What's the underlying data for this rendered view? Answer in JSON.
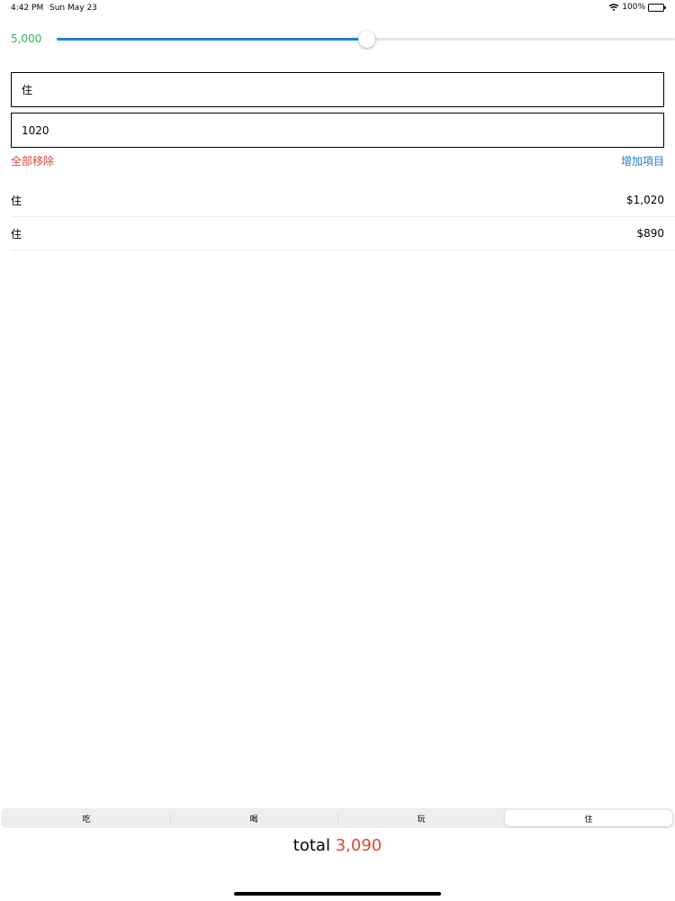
{
  "status_bar": {
    "time": "4:42 PM",
    "date": "Sun May 23",
    "battery": "100%"
  },
  "slider": {
    "value_label": "5,000",
    "fraction": 0.5,
    "label_color": "#2fb55a",
    "fill_color": "#1e7fd8"
  },
  "form": {
    "name_value": "住",
    "amount_value": "1020"
  },
  "actions": {
    "remove_all": "全部移除",
    "add_item": "增加項目"
  },
  "items": [
    {
      "name": "住",
      "amount": "$1,020"
    },
    {
      "name": "住",
      "amount": "$890"
    }
  ],
  "categories": {
    "options": [
      "吃",
      "喝",
      "玩",
      "住"
    ],
    "selected": "住"
  },
  "total": {
    "label": "total",
    "value": "3,090",
    "value_color": "#e0463c"
  }
}
